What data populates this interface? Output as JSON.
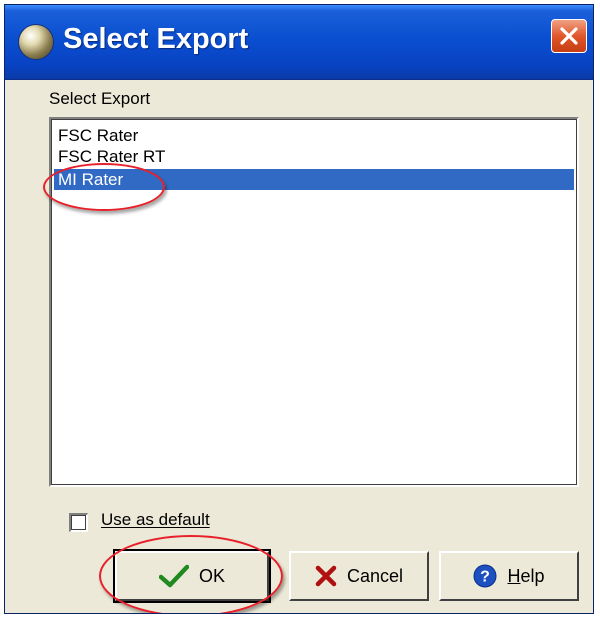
{
  "dialog": {
    "title": "Select Export",
    "list_label": "Select Export",
    "items": [
      "FSC Rater",
      "FSC Rater RT",
      "MI Rater"
    ],
    "selected_index": 2,
    "checkbox": {
      "label": "Use as default",
      "checked": false
    },
    "buttons": {
      "ok": "OK",
      "cancel": "Cancel",
      "help_mnemonic": "H",
      "help_rest": "elp"
    },
    "icons": [
      "app-icon",
      "close-icon",
      "checkmark-icon",
      "cancel-x-icon",
      "help-question-icon"
    ]
  },
  "colors": {
    "titlebar": "#0a4fd0",
    "selection": "#316ac5",
    "annotation": "#e8202a",
    "close": "#e1572b"
  }
}
